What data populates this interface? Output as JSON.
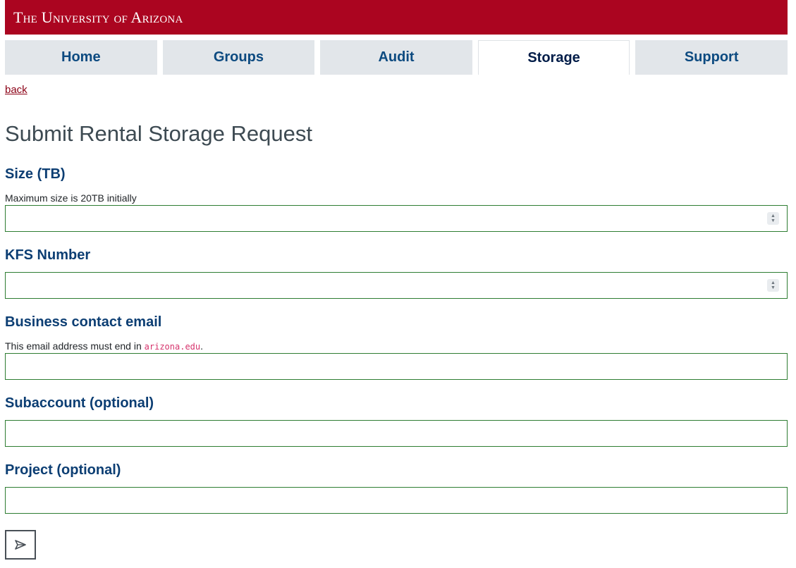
{
  "banner": {
    "logo_text": "The University of Arizona"
  },
  "tabs": [
    {
      "label": "Home",
      "active": false
    },
    {
      "label": "Groups",
      "active": false
    },
    {
      "label": "Audit",
      "active": false
    },
    {
      "label": "Storage",
      "active": true
    },
    {
      "label": "Support",
      "active": false
    }
  ],
  "back_link": "back",
  "page_title": "Submit Rental Storage Request",
  "form": {
    "size": {
      "label": "Size (TB)",
      "help": "Maximum size is 20TB initially",
      "value": ""
    },
    "kfs": {
      "label": "KFS Number",
      "value": ""
    },
    "email": {
      "label": "Business contact email",
      "help_prefix": "This email address must end in ",
      "help_code": "arizona.edu",
      "help_suffix": ".",
      "value": ""
    },
    "subaccount": {
      "label": "Subaccount (optional)",
      "value": ""
    },
    "project": {
      "label": "Project (optional)",
      "value": ""
    }
  },
  "submit_icon": "send-icon",
  "colors": {
    "brand_red": "#ab0520",
    "tab_bg": "#e2e6ea",
    "tab_text": "#0c4a80",
    "label_blue": "#0c3e73",
    "input_border": "#2e7d32"
  }
}
